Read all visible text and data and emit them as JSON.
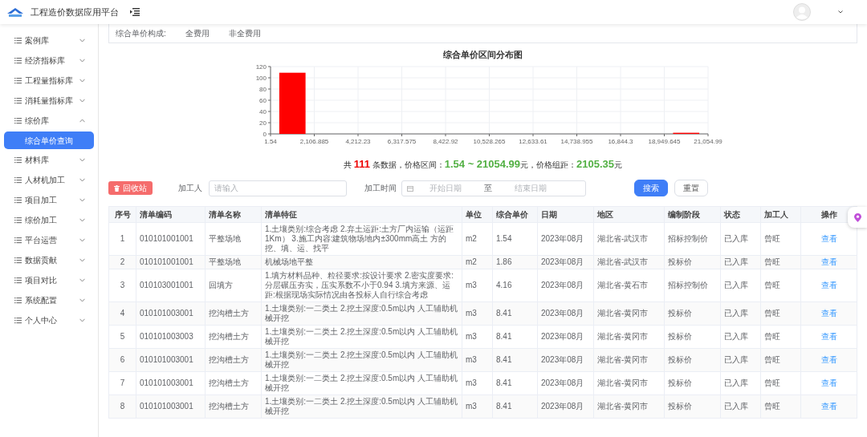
{
  "header": {
    "title": "工程造价数据应用平台"
  },
  "sidebar": {
    "items": [
      {
        "label": "案例库",
        "expanded": false
      },
      {
        "label": "经济指标库",
        "expanded": false
      },
      {
        "label": "工程量指标库",
        "expanded": false
      },
      {
        "label": "消耗量指标库",
        "expanded": false
      },
      {
        "label": "综价库",
        "expanded": true,
        "children": [
          {
            "label": "综合单价查询",
            "selected": true
          }
        ]
      },
      {
        "label": "材料库",
        "expanded": false
      },
      {
        "label": "人材机加工",
        "expanded": false
      },
      {
        "label": "项目加工",
        "expanded": false
      },
      {
        "label": "综价加工",
        "expanded": false
      },
      {
        "label": "平台运营",
        "expanded": false
      },
      {
        "label": "数据贡献",
        "expanded": false
      },
      {
        "label": "项目对比",
        "expanded": false
      },
      {
        "label": "系统配置",
        "expanded": false
      },
      {
        "label": "个人中心",
        "expanded": false
      }
    ]
  },
  "filter_card": {
    "label": "综合单价构成:",
    "options": [
      {
        "label": "全费用"
      },
      {
        "label": "非全费用"
      }
    ]
  },
  "chart": {
    "chart_data": {
      "type": "bar",
      "title": "综合单价区间分布图",
      "grid": true,
      "x": [
        1054.2125,
        3159.5575,
        5264.9025,
        7370.2475,
        9475.5925,
        11580.9375,
        13686.2825,
        15791.6275,
        17896.9725,
        20002.3175
      ],
      "series": [
        {
          "color": "#ff0000",
          "values": [
            109,
            0,
            0,
            0,
            0,
            0,
            0,
            0,
            0,
            2
          ]
        }
      ],
      "xlim": [
        1.54,
        21054.99
      ],
      "ylim": [
        0,
        120
      ],
      "yticks": [
        0,
        20,
        40,
        60,
        80,
        100,
        120
      ],
      "xticks": [
        {
          "value": 1.54,
          "label": "1.54"
        },
        {
          "value": 2106.885,
          "label": "2,106.885"
        },
        {
          "value": 4212.23,
          "label": "4,212.23"
        },
        {
          "value": 6317.575,
          "label": "6,317.575"
        },
        {
          "value": 8422.92,
          "label": "8,422.92"
        },
        {
          "value": 10528.265,
          "label": "10,528.265"
        },
        {
          "value": 12633.61,
          "label": "12,633.61"
        },
        {
          "value": 14738.955,
          "label": "14,738.955"
        },
        {
          "value": 16844.3,
          "label": "16,844.3"
        },
        {
          "value": 18949.645,
          "label": "18,949.645"
        },
        {
          "value": 21054.99,
          "label": "21,054.99"
        }
      ]
    }
  },
  "summary": {
    "parts": [
      {
        "kind": "plain",
        "text": "共 "
      },
      {
        "kind": "count",
        "text": "111"
      },
      {
        "kind": "plain",
        "text": " 条数据，价格区间："
      },
      {
        "kind": "value",
        "text": "1.54 ~ 21054.99"
      },
      {
        "kind": "plain",
        "text": "元，价格组距："
      },
      {
        "kind": "value",
        "text": "2105.35"
      },
      {
        "kind": "plain",
        "text": "元"
      }
    ]
  },
  "toolbar": {
    "recycle_button": "回收站",
    "processor_label": "加工人",
    "processor_placeholder": "请输入",
    "time_label": "加工时间",
    "start_placeholder": "开始日期",
    "separator": "至",
    "end_placeholder": "结束日期",
    "search_button": "搜索",
    "reset_button": "重置"
  },
  "table": {
    "columns": [
      "序号",
      "清单编码",
      "清单名称",
      "清单特征",
      "单位",
      "综合单价",
      "日期",
      "地区",
      "编制阶段",
      "状态",
      "加工人",
      "操作"
    ],
    "rows": [
      {
        "cells": [
          "1",
          "010101001001",
          "平整场地",
          "1.土壤类别:综合考虑 2.弃土运距:土方厂内运输（运距1Km） 3.施工内容:建筑物场地内±300mm高土 方的挖、填、运、找平",
          "m2",
          "1.54",
          "2023年08月",
          "湖北省-武汉市",
          "招标控制价",
          "已入库",
          "曾旺"
        ],
        "action": "查看"
      },
      {
        "cells": [
          "2",
          "010101001001",
          "平整场地",
          "机械场地平整",
          "m2",
          "1.86",
          "2023年08月",
          "湖北省-武汉市",
          "投标价",
          "已入库",
          "曾旺"
        ],
        "action": "查看"
      },
      {
        "cells": [
          "3",
          "010103001001",
          "回填方",
          "1.填方材料品种、粒径要求:按设计要求 2.密实度要求:分层碾压夯实，压实系数不小于0.94 3.填方来源、运距:根据现场实际情况由各投标人自行综合考虑",
          "m3",
          "4.16",
          "2023年08月",
          "湖北省-黄石市",
          "招标控制价",
          "已入库",
          "曾旺"
        ],
        "action": "查看"
      },
      {
        "cells": [
          "4",
          "010101003001",
          "挖沟槽土方",
          "1.土壤类别:一二类土 2.挖土深度:0.5m以内 人工辅助机械开挖",
          "m3",
          "8.41",
          "2023年08月",
          "湖北省-黄冈市",
          "投标价",
          "已入库",
          "曾旺"
        ],
        "action": "查看"
      },
      {
        "cells": [
          "5",
          "010101003003",
          "挖沟槽土方",
          "1.土壤类别:一二类土 2.挖土深度:0.5m以内 人工辅助机械开挖",
          "m3",
          "8.41",
          "2023年08月",
          "湖北省-黄冈市",
          "投标价",
          "已入库",
          "曾旺"
        ],
        "action": "查看"
      },
      {
        "cells": [
          "6",
          "010101003001",
          "挖沟槽土方",
          "1.土壤类别:一二类土 2.挖土深度:0.5m以内 人工辅助机械开挖",
          "m3",
          "8.41",
          "2023年08月",
          "湖北省-黄冈市",
          "投标价",
          "已入库",
          "曾旺"
        ],
        "action": "查看"
      },
      {
        "cells": [
          "7",
          "010101003001",
          "挖沟槽土方",
          "1.土壤类别:一二类土 2.挖土深度:0.5m以内 人工辅助机械开挖",
          "m3",
          "8.41",
          "2023年08月",
          "湖北省-黄冈市",
          "投标价",
          "已入库",
          "曾旺"
        ],
        "action": "查看"
      },
      {
        "cells": [
          "8",
          "010101003001",
          "挖沟槽土方",
          "1.土壤类别:一二类土 2.挖土深度:0.5m以内 人工辅助机械开挖",
          "m3",
          "8.41",
          "2023年08月",
          "湖北省-黄冈市",
          "投标价",
          "已入库",
          "曾旺"
        ],
        "action": "查看"
      }
    ]
  }
}
